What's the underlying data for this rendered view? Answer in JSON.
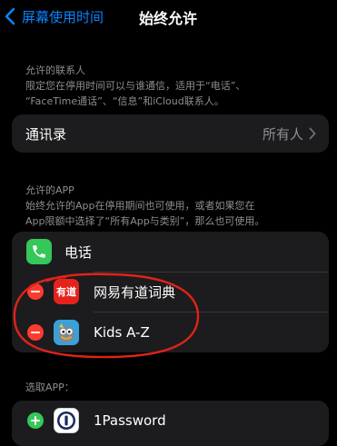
{
  "nav": {
    "back_label": "屏幕使用时间",
    "title": "始终允许"
  },
  "contacts_section": {
    "header": "允许的联系人",
    "description_line1": "限定您在停用时间可以与谁通信，适用于“电话”、",
    "description_line2": "“FaceTime通话”、“信息”和iCloud联系人。",
    "row_label": "通讯录",
    "row_value": "所有人"
  },
  "apps_section": {
    "header": "允许的APP",
    "description_line1": "始终允许的App在停用期间也可使用，或者如果您在",
    "description_line2": "App限额中选择了“所有App与类别”，那么也可使用。",
    "items": [
      {
        "name": "电话",
        "icon": "phone-icon",
        "removable": false
      },
      {
        "name": "网易有道词典",
        "icon": "youdao-icon",
        "icon_text": "有道",
        "removable": true
      },
      {
        "name": "Kids A-Z",
        "icon": "kids-az-icon",
        "removable": true
      }
    ]
  },
  "choose_section": {
    "header": "选取APP：",
    "items": [
      {
        "name": "1Password",
        "icon": "onepassword-icon"
      }
    ]
  },
  "colors": {
    "accent": "#0a84ff",
    "remove": "#ff3b30",
    "add": "#34c759",
    "annotation": "#e0221a"
  }
}
